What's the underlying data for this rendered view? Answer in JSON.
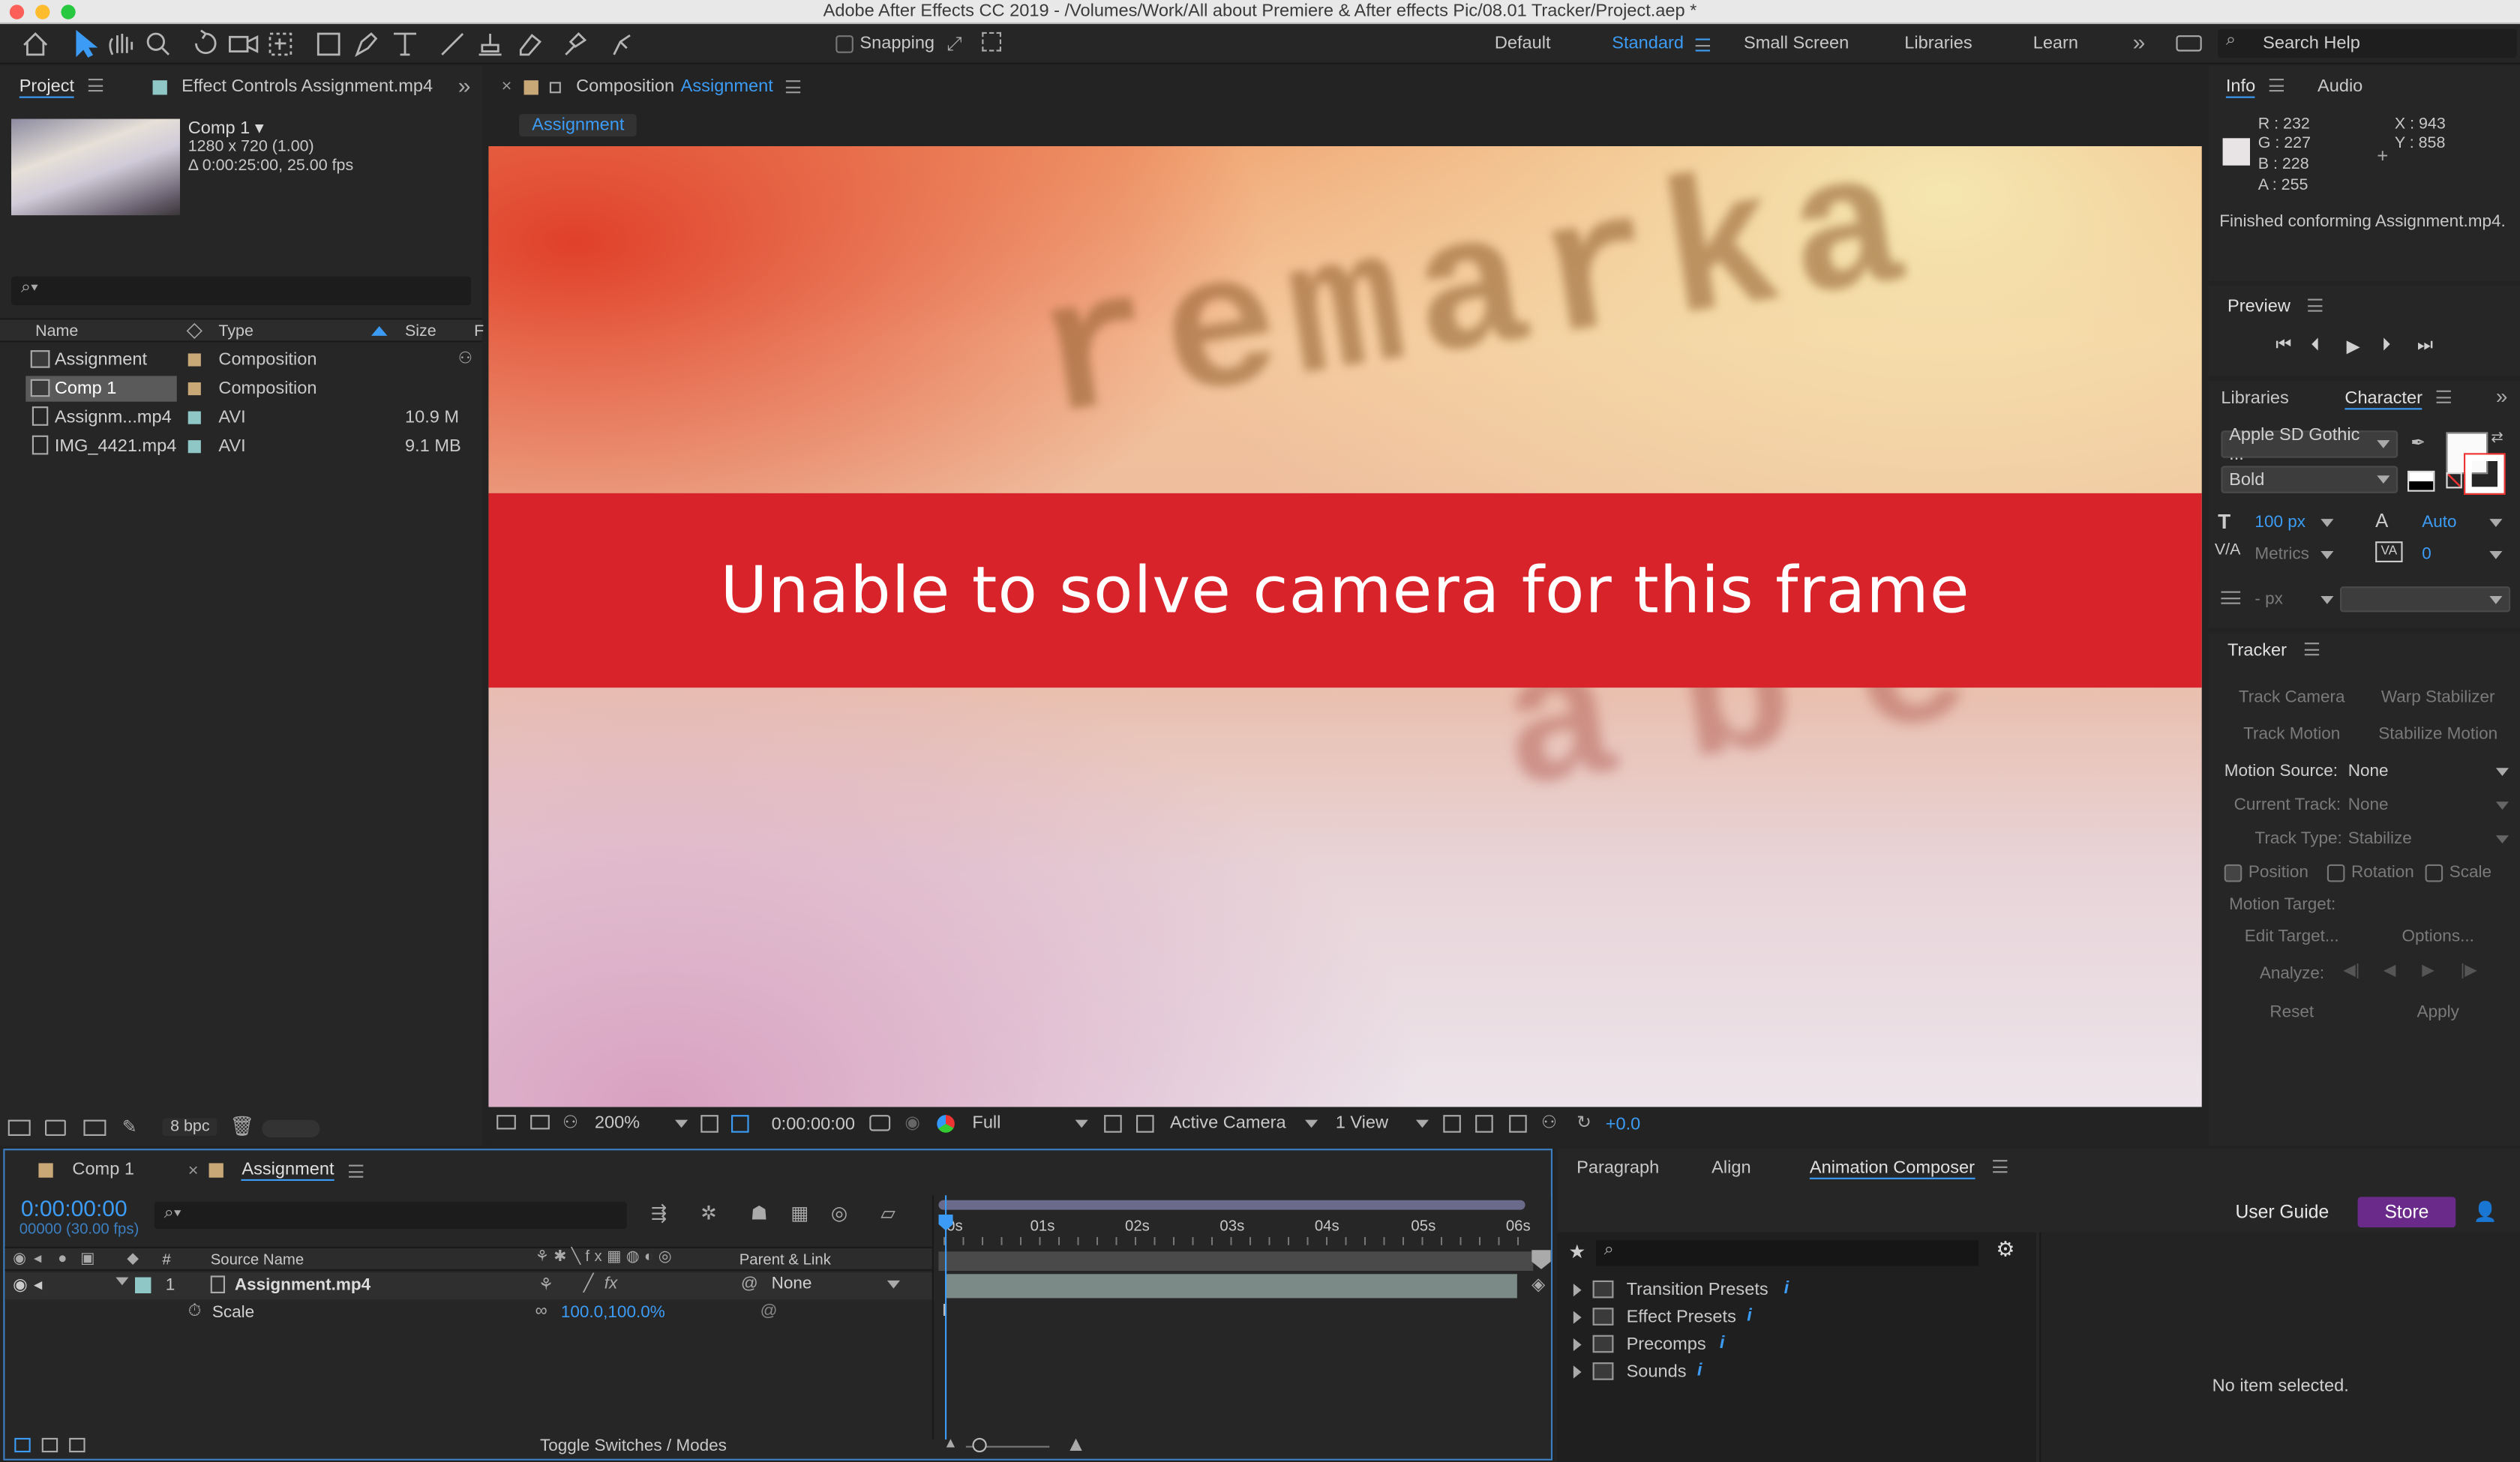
{
  "window": {
    "title": "Adobe After Effects CC 2019 - /Volumes/Work/All about Premiere & After effects Pic/08.01 Tracker/Project.aep *"
  },
  "toolbar": {
    "snapping_label": "Snapping",
    "workspaces": [
      "Default",
      "Standard",
      "Small Screen",
      "Libraries",
      "Learn"
    ],
    "search_placeholder": "Search Help"
  },
  "project": {
    "tab_project": "Project",
    "tab_effect_controls": "Effect Controls Assignment.mp4",
    "selected_name": "Comp 1",
    "selected_info1": "1280 x 720 (1.00)",
    "selected_info2": "Δ 0:00:25:00, 25.00 fps",
    "col_name": "Name",
    "col_type": "Type",
    "col_size": "Size",
    "col_f": "F",
    "items": [
      {
        "name": "Assignment",
        "type": "Composition",
        "size": "",
        "color": "#c9a878"
      },
      {
        "name": "Comp 1",
        "type": "Composition",
        "size": "",
        "color": "#c9a878"
      },
      {
        "name": "Assignm...mp4",
        "type": "AVI",
        "size": "10.9 M",
        "color": "#8fc7c7"
      },
      {
        "name": "IMG_4421.mp4",
        "type": "AVI",
        "size": "9.1 MB",
        "color": "#8fc7c7"
      }
    ],
    "bpc": "8 bpc"
  },
  "composition": {
    "tab_prefix": "Composition",
    "tab_name": "Assignment",
    "subtab": "Assignment",
    "warning": "Unable to solve camera for this frame",
    "bg_text_top": "remarka",
    "bg_text_bottom": "abe",
    "zoom": "200%",
    "timecode": "0:00:00:00",
    "resolution": "Full",
    "camera": "Active Camera",
    "views": "1 View",
    "exposure": "+0.0"
  },
  "info": {
    "tab_info": "Info",
    "tab_audio": "Audio",
    "r": "R : 232",
    "g": "G : 227",
    "b": "B : 228",
    "a": "A : 255",
    "x": "X : 943",
    "y": "Y : 858",
    "status": "Finished conforming Assignment.mp4."
  },
  "preview": {
    "title": "Preview"
  },
  "character": {
    "tab_libraries": "Libraries",
    "tab_character": "Character",
    "font": "Apple SD Gothic ...",
    "style": "Bold",
    "size": "100 px",
    "leading": "Auto",
    "kerning": "Metrics",
    "tracking": "0",
    "stroke": "- px"
  },
  "tracker": {
    "title": "Tracker",
    "track_camera": "Track Camera",
    "warp_stabilizer": "Warp Stabilizer",
    "track_motion": "Track Motion",
    "stabilize_motion": "Stabilize Motion",
    "motion_source_label": "Motion Source:",
    "motion_source_value": "None",
    "current_track_label": "Current Track:",
    "current_track_value": "None",
    "track_type_label": "Track Type:",
    "track_type_value": "Stabilize",
    "position": "Position",
    "rotation": "Rotation",
    "scale": "Scale",
    "motion_target": "Motion Target:",
    "edit_target": "Edit Target...",
    "options": "Options...",
    "analyze": "Analyze:",
    "reset": "Reset",
    "apply": "Apply"
  },
  "timeline": {
    "tab_comp1": "Comp 1",
    "tab_assignment": "Assignment",
    "timecode": "0:00:00:00",
    "frames": "00000 (30.00 fps)",
    "col_num": "#",
    "col_source": "Source Name",
    "col_parent": "Parent & Link",
    "layer_num": "1",
    "layer_name": "Assignment.mp4",
    "layer_parent": "None",
    "prop_name": "Scale",
    "prop_value": "100.0,100.0%",
    "ruler": [
      "0s",
      "01s",
      "02s",
      "03s",
      "04s",
      "05s",
      "06s"
    ],
    "toggle": "Toggle Switches / Modes"
  },
  "bottom_right": {
    "tab_paragraph": "Paragraph",
    "tab_align": "Align",
    "tab_animation": "Animation Composer",
    "user_guide": "User Guide",
    "store": "Store",
    "tree": [
      "Transition Presets",
      "Effect Presets",
      "Precomps",
      "Sounds"
    ],
    "info_icon": "i",
    "empty": "No item selected."
  }
}
